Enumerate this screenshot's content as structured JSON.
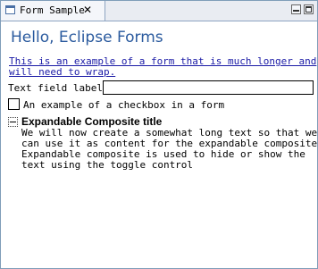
{
  "view": {
    "tab_title": "Form Sample",
    "close_symbol": "✕",
    "icons": [
      "view-icon",
      "close-icon",
      "minimize-icon",
      "maximize-icon"
    ]
  },
  "form": {
    "title": "Hello, Eclipse Forms",
    "link_lines": [
      "This is an example of a form that is much longer and",
      "will need to wrap."
    ],
    "text_field_label": "Text field label:",
    "text_field_value": "",
    "checkbox_label": "An example of a checkbox in a form",
    "checkbox_checked": false
  },
  "expandable": {
    "title": "Expandable Composite title",
    "expanded": true,
    "text_lines": [
      "We will now create a somewhat long text so that we",
      "can use it as content for the expandable composite.",
      "Expandable composite is used to hide or show the",
      "text using the toggle control"
    ]
  },
  "colors": {
    "title": "#2a5a9e",
    "link": "#1a1aa6",
    "border": "#7f9db9"
  }
}
